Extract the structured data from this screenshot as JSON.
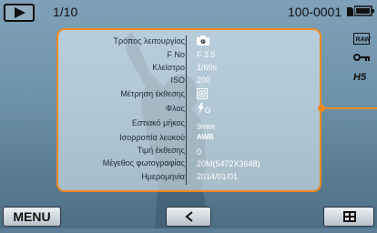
{
  "topbar": {
    "counter": "1/10",
    "file_number": "100-0001"
  },
  "info": {
    "rows": [
      {
        "label": "Τρόπος λειτουργίας",
        "value": "",
        "icon": "camera-mode-icon"
      },
      {
        "label": "F No",
        "value": "F 3.5"
      },
      {
        "label": "Κλείστρο",
        "value": "1/60s"
      },
      {
        "label": "ISO",
        "value": "200"
      },
      {
        "label": "Μέτρηση έκθεσης",
        "value": "",
        "icon": "metering-icon"
      },
      {
        "label": "Φλας",
        "value": "",
        "icon": "flash-icon"
      },
      {
        "label": "Εστιακό μήκος",
        "value": "9mm"
      },
      {
        "label": "Ισορροπία λευκού",
        "value": "AWB"
      },
      {
        "label": "Τιμή έκθεσης",
        "value": "0"
      },
      {
        "label": "Μέγεθος φωτογραφίας",
        "value": "20M(5472X3648)"
      },
      {
        "label": "Ημερομηνία",
        "value": "2014/01/01"
      }
    ]
  },
  "side_icons": [
    "RAW",
    "key-icon",
    "H5"
  ],
  "bottom": {
    "menu_label": "MENU"
  },
  "colors": {
    "accent": "#f08a1e",
    "label_text": "#1b2a36",
    "value_text": "#ffffff"
  }
}
